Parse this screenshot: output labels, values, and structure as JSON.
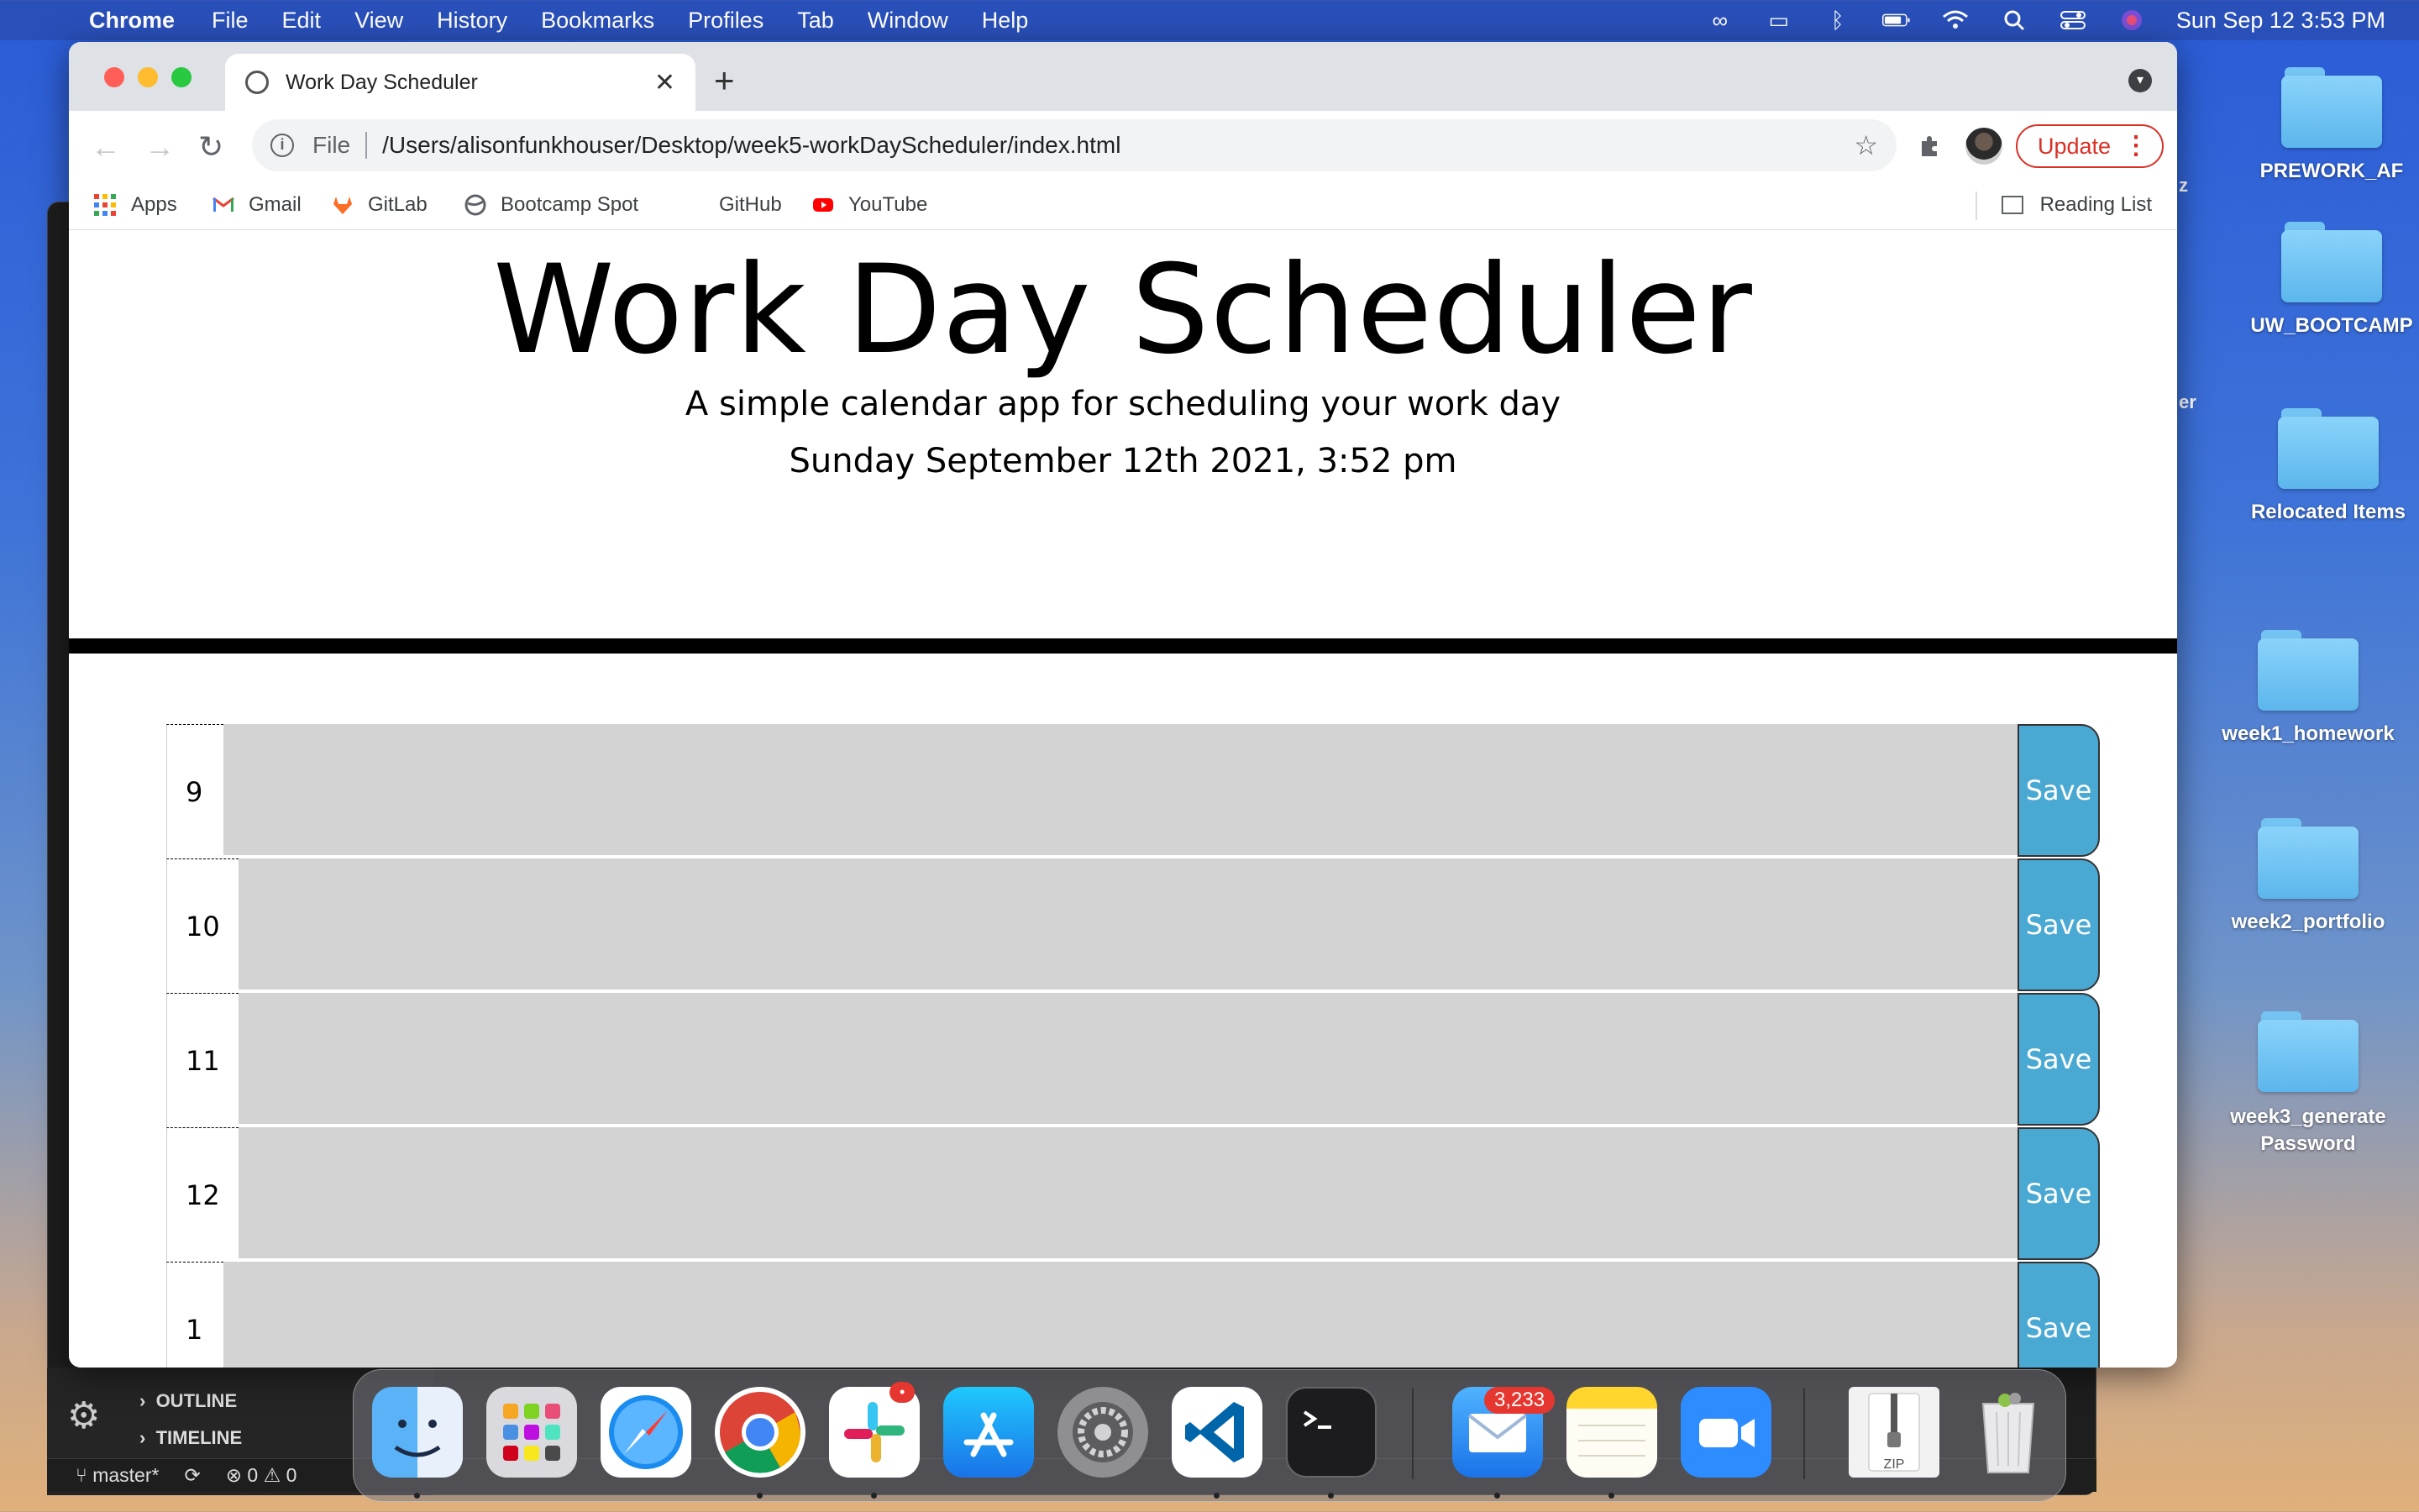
{
  "menubar": {
    "app_name": "Chrome",
    "items": [
      "File",
      "Edit",
      "View",
      "History",
      "Bookmarks",
      "Profiles",
      "Tab",
      "Window",
      "Help"
    ],
    "clock": "Sun Sep 12  3:53 PM"
  },
  "desktop": {
    "folders": [
      "PREWORK_AF",
      "UW_BOOTCAMP",
      "Relocated Items",
      "week1_homework",
      "week2_portfolio",
      "week3_generatePassword"
    ],
    "partial_labels": [
      "z",
      "er"
    ]
  },
  "vscode": {
    "outline": "OUTLINE",
    "timeline": "TIMELINE",
    "branch": "master*",
    "errors": "0",
    "warnings": "0"
  },
  "browser": {
    "tab_title": "Work Day Scheduler",
    "address_scheme": "File",
    "address_url": "/Users/alisonfunkhouser/Desktop/week5-workDayScheduler/index.html",
    "update_label": "Update",
    "bookmarks": [
      "Apps",
      "Gmail",
      "GitLab",
      "Bootcamp Spot",
      "GitHub",
      "YouTube"
    ],
    "reading_list": "Reading List"
  },
  "page": {
    "title": "Work Day Scheduler",
    "lead": "A simple calendar app for scheduling your work day",
    "current_day": "Sunday September 12th 2021, 3:52 pm",
    "save_label": "Save",
    "hours": [
      "9",
      "10",
      "11",
      "12",
      "1"
    ]
  },
  "dock": {
    "mail_badge": "3,233",
    "apps": [
      "Finder",
      "Launchpad",
      "Safari",
      "Chrome",
      "Slack",
      "App Store",
      "System Preferences",
      "Visual Studio Code",
      "Terminal",
      "Mail",
      "Notes",
      "Zoom",
      "Archive",
      "Trash"
    ],
    "archive_label": "ZIP"
  }
}
